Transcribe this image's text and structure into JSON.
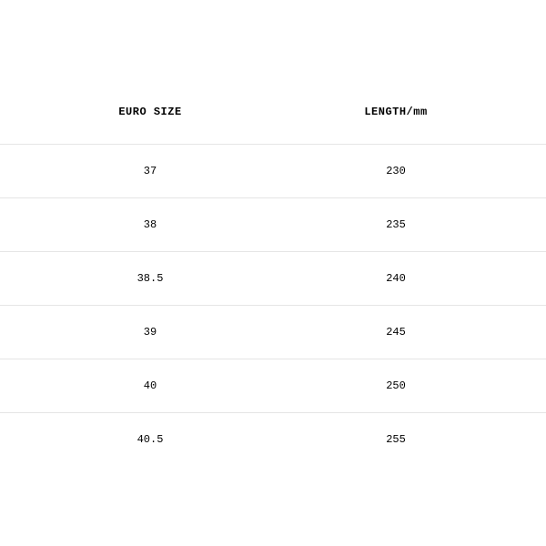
{
  "table": {
    "headers": [
      "EURO SIZE",
      "LENGTH/mm"
    ],
    "rows": [
      {
        "size": "37",
        "length": "230"
      },
      {
        "size": "38",
        "length": "235"
      },
      {
        "size": "38.5",
        "length": "240"
      },
      {
        "size": "39",
        "length": "245"
      },
      {
        "size": "40",
        "length": "250"
      },
      {
        "size": "40.5",
        "length": "255"
      }
    ]
  }
}
